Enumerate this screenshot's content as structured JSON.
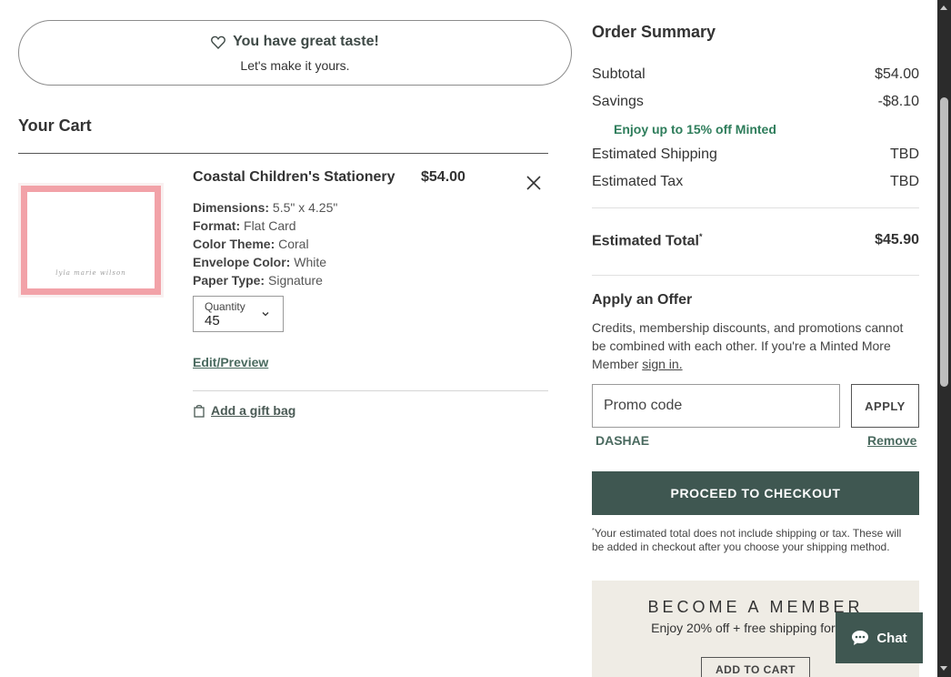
{
  "banner": {
    "title": "You have great taste!",
    "subtitle": "Let's make it yours."
  },
  "cart": {
    "heading": "Your Cart",
    "item": {
      "name": "Coastal Children's Stationery",
      "price": "$54.00",
      "preview_script": "lyla marie wilson",
      "attributes": [
        {
          "label": "Dimensions:",
          "value": " 5.5\" x 4.25\""
        },
        {
          "label": "Format:",
          "value": " Flat Card"
        },
        {
          "label": "Color Theme:",
          "value": " Coral"
        },
        {
          "label": "Envelope Color:",
          "value": " White"
        },
        {
          "label": "Paper Type:",
          "value": " Signature"
        }
      ],
      "quantity_label": "Quantity",
      "quantity_value": "45",
      "edit_label": "Edit/Preview",
      "gift_label": "Add a gift bag"
    }
  },
  "summary": {
    "title": "Order Summary",
    "subtotal_label": "Subtotal",
    "subtotal_value": "$54.00",
    "savings_label": "Savings",
    "savings_value": "-$8.10",
    "savings_note": "Enjoy up to 15% off Minted",
    "shipping_label": "Estimated Shipping",
    "shipping_value": "TBD",
    "tax_label": "Estimated Tax",
    "tax_value": "TBD",
    "total_label": "Estimated Total",
    "total_mark": "*",
    "total_value": "$45.90"
  },
  "offer": {
    "title": "Apply an Offer",
    "text": "Credits, membership discounts, and promotions cannot be combined with each other. If you're a Minted More Member ",
    "signin_label": "sign in.",
    "promo_placeholder": "Promo code",
    "apply_label": "APPLY",
    "applied_code": "DASHAE",
    "remove_label": "Remove"
  },
  "checkout": {
    "button_label": "PROCEED TO CHECKOUT",
    "disclaimer_mark": "*",
    "disclaimer": "Your estimated total does not include shipping or tax. These will be added in checkout after you choose your shipping method."
  },
  "membership": {
    "title": "BECOME A MEMBER",
    "subtitle": "Enjoy 20% off + free shipping for $39",
    "button_label": "ADD TO CART"
  },
  "chat": {
    "label": "Chat"
  },
  "colors": {
    "brand": "#3f5751",
    "savings_note": "#2e7d5b",
    "link": "#4a6a5f",
    "member_bg": "#efece5"
  }
}
